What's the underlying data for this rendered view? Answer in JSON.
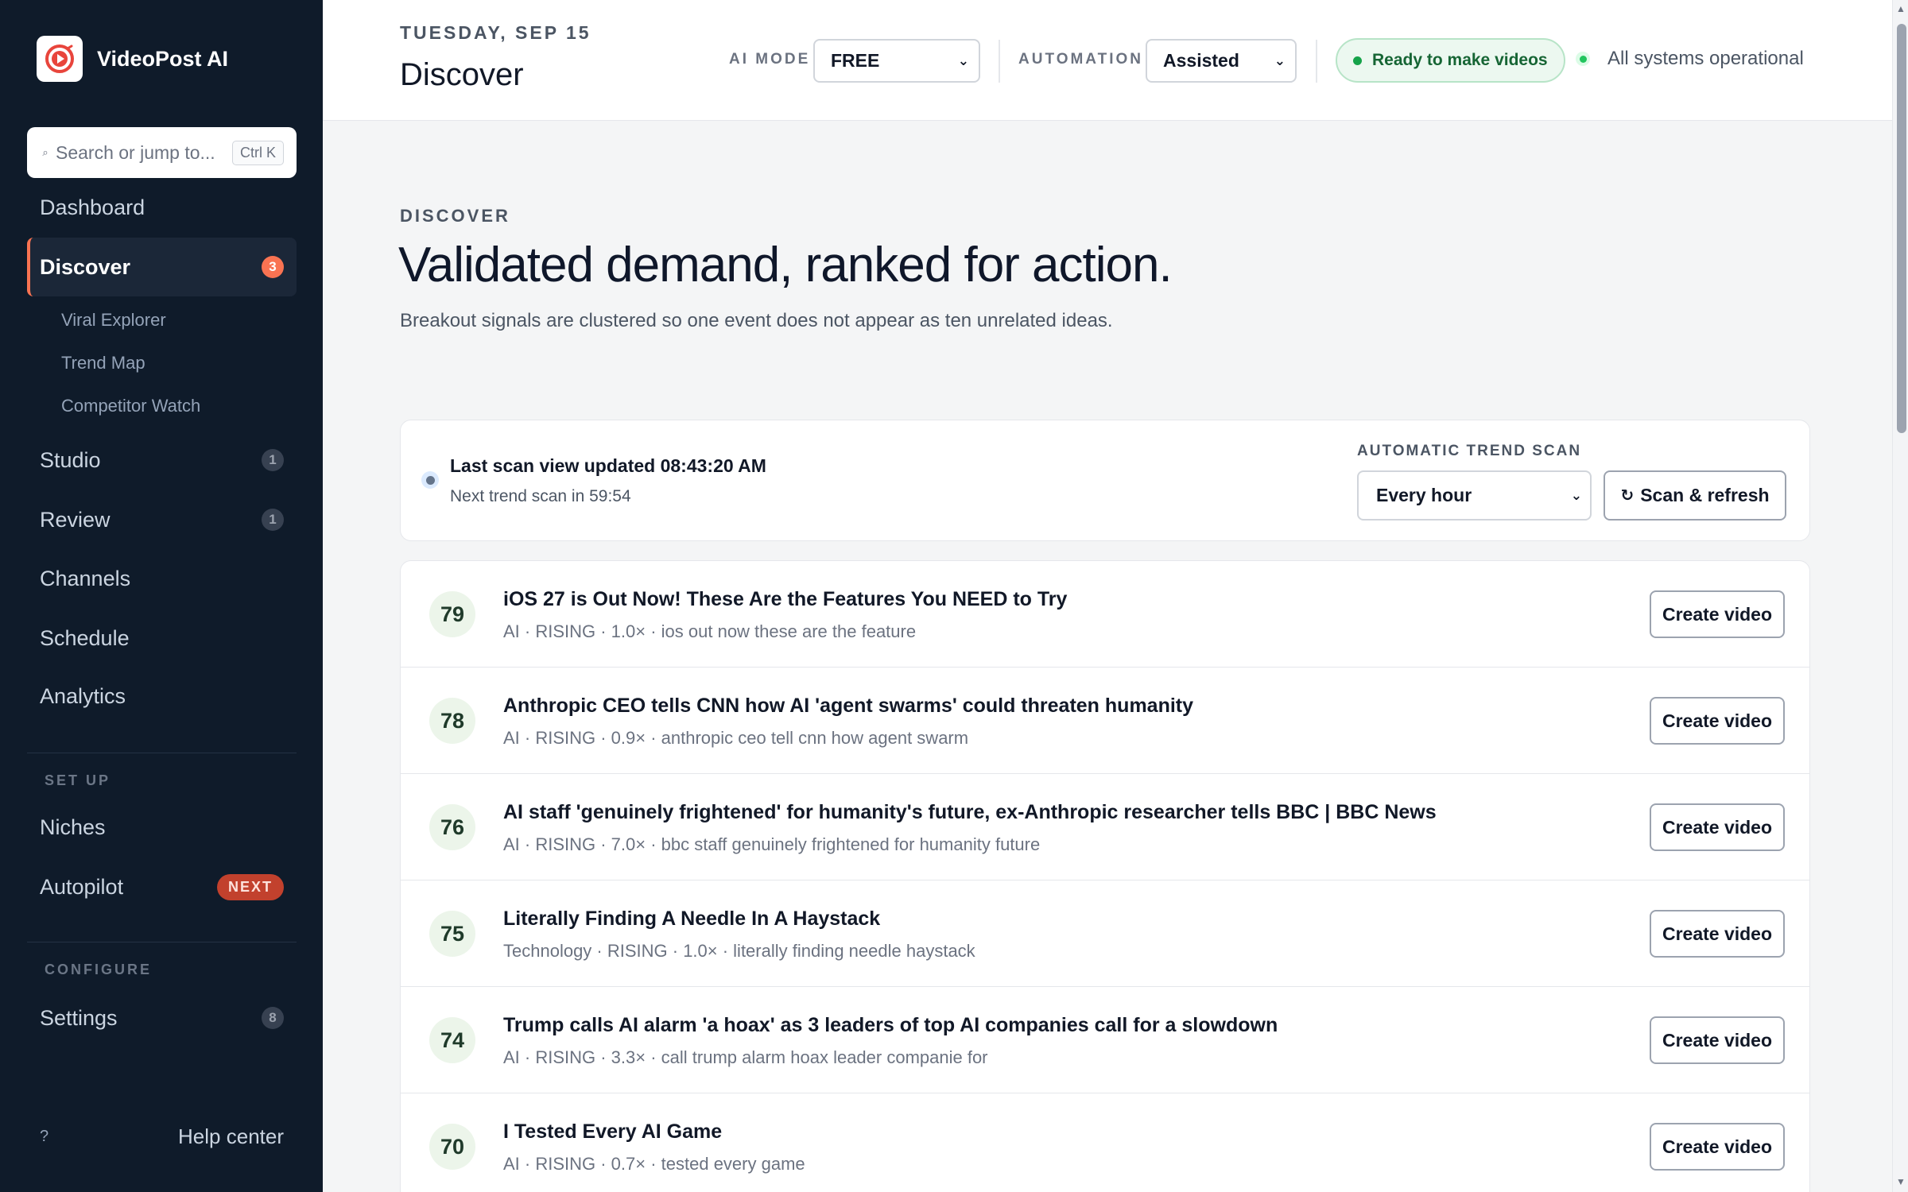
{
  "app": {
    "name": "VideoPost AI",
    "search_placeholder": "Search or jump to...",
    "search_shortcut": "Ctrl K"
  },
  "sidebar": {
    "items": [
      {
        "label": "Dashboard",
        "badge": ""
      },
      {
        "label": "Discover",
        "badge": "3",
        "active": true
      },
      {
        "label": "Studio",
        "badge": "1"
      },
      {
        "label": "Review",
        "badge": "1"
      },
      {
        "label": "Channels",
        "badge": ""
      },
      {
        "label": "Schedule",
        "badge": ""
      },
      {
        "label": "Analytics",
        "badge": ""
      }
    ],
    "discover_subitems": [
      "Viral Explorer",
      "Trend Map",
      "Competitor Watch"
    ],
    "setup_label": "SET UP",
    "setup_items": [
      {
        "label": "Niches",
        "pill": ""
      },
      {
        "label": "Autopilot",
        "pill": "NEXT"
      }
    ],
    "configure_label": "CONFIGURE",
    "configure_items": [
      {
        "label": "Settings",
        "badge": "8"
      }
    ],
    "help_icon": "?",
    "help_label": "Help center"
  },
  "header": {
    "date": "TUESDAY, SEP 15",
    "title": "Discover",
    "ai_mode_label": "AI MODE",
    "ai_mode_value": "FREE",
    "automation_label": "AUTOMATION",
    "automation_value": "Assisted",
    "ready_text": "Ready to make videos",
    "status_text": "All systems operational"
  },
  "main": {
    "eyebrow": "DISCOVER",
    "title": "Validated demand, ranked for action.",
    "subtitle": "Breakout signals are clustered so one event does not appear as ten unrelated ideas."
  },
  "scan": {
    "title": "Last scan view updated 08:43:20 AM",
    "next": "Next trend scan in 59:54",
    "label": "AUTOMATIC TREND SCAN",
    "frequency": "Every hour",
    "button": "Scan & refresh"
  },
  "trends": [
    {
      "score": "79",
      "title": "iOS 27 is Out Now! These Are the Features You NEED to Try",
      "meta": "AI · RISING · 1.0× · ios out now these are the feature",
      "action": "Create video"
    },
    {
      "score": "78",
      "title": "Anthropic CEO tells CNN how AI 'agent swarms' could threaten humanity",
      "meta": "AI · RISING · 0.9× · anthropic ceo tell cnn how agent swarm",
      "action": "Create video"
    },
    {
      "score": "76",
      "title": "AI staff 'genuinely frightened' for humanity's future, ex-Anthropic researcher tells BBC | BBC News",
      "meta": "AI · RISING · 7.0× · bbc staff genuinely frightened for humanity future",
      "action": "Create video"
    },
    {
      "score": "75",
      "title": "Literally Finding A Needle In A Haystack",
      "meta": "Technology · RISING · 1.0× · literally finding needle haystack",
      "action": "Create video"
    },
    {
      "score": "74",
      "title": "Trump calls AI alarm 'a hoax' as 3 leaders of top AI companies call for a slowdown",
      "meta": "AI · RISING · 3.3× · call trump alarm hoax leader companie for",
      "action": "Create video"
    },
    {
      "score": "70",
      "title": "I Tested Every AI Game",
      "meta": "AI · RISING · 0.7× · tested every game",
      "action": "Create video"
    }
  ],
  "colors": {
    "sidebar_bg": "#0f1b2a",
    "accent": "#f97352",
    "success": "#16a34a"
  }
}
